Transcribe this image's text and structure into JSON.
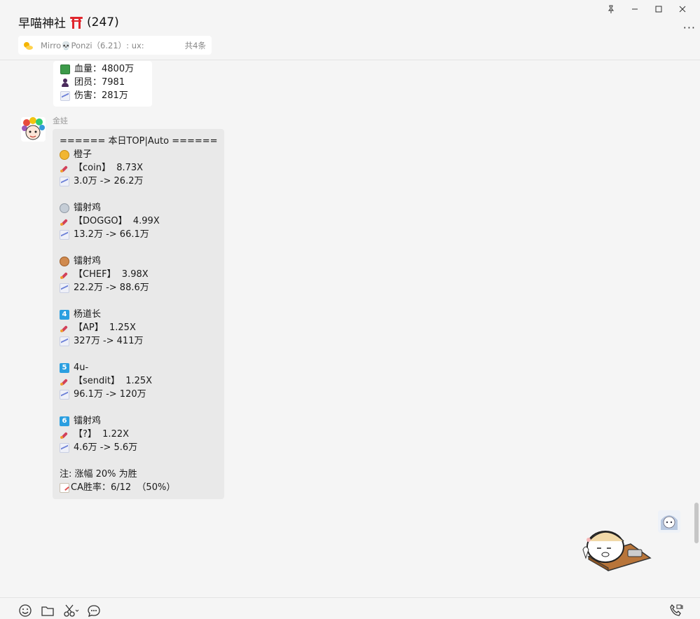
{
  "header": {
    "title": "早喵神社",
    "member_count": "(247)",
    "window_controls": [
      "pin-icon",
      "minimize-icon",
      "maximize-icon",
      "close-icon"
    ],
    "more_label": "···"
  },
  "pinned": {
    "text": "Mirro💀Ponzi（6.21）: ux:",
    "count": "共4条"
  },
  "messages": [
    {
      "lines": [
        {
          "icon": "money-icon",
          "text": "血量：4800万"
        },
        {
          "icon": "person-icon",
          "text": "团员：7981"
        },
        {
          "icon": "chart-icon",
          "text": "伤害：281万"
        }
      ]
    },
    {
      "sender": "金娃",
      "header": "====== 本日TOP|Auto ======",
      "entries": [
        {
          "rank_icon": "gold-medal-icon",
          "rank": "",
          "name": "橙子",
          "token": "【coin】  8.73X",
          "change": "3.0万 -> 26.2万"
        },
        {
          "rank_icon": "silver-medal-icon",
          "rank": "",
          "name": "镭射鸡",
          "token": "【DOGGO】  4.99X",
          "change": "13.2万 -> 66.1万"
        },
        {
          "rank_icon": "bronze-medal-icon",
          "rank": "",
          "name": "镭射鸡",
          "token": "【CHEF】  3.98X",
          "change": "22.2万 -> 88.6万"
        },
        {
          "rank_icon": "number-4-icon",
          "rank": "4",
          "name": "杨道长",
          "token": "【AP】  1.25X",
          "change": "327万 -> 411万"
        },
        {
          "rank_icon": "number-5-icon",
          "rank": "5",
          "name": "4u-",
          "token": "【sendit】  1.25X",
          "change": "96.1万 -> 120万"
        },
        {
          "rank_icon": "number-6-icon",
          "rank": "6",
          "name": "镭射鸡",
          "token": "【?】  1.22X",
          "change": "4.6万 -> 5.6万"
        }
      ],
      "note": "注: 涨幅 20% 为胜",
      "winrate": "CA胜率：6/12  （50%）"
    }
  ],
  "toolbar": [
    "emoji-icon",
    "folder-icon",
    "scissors-icon",
    "chat-bubble-icon",
    "video-call-icon"
  ]
}
